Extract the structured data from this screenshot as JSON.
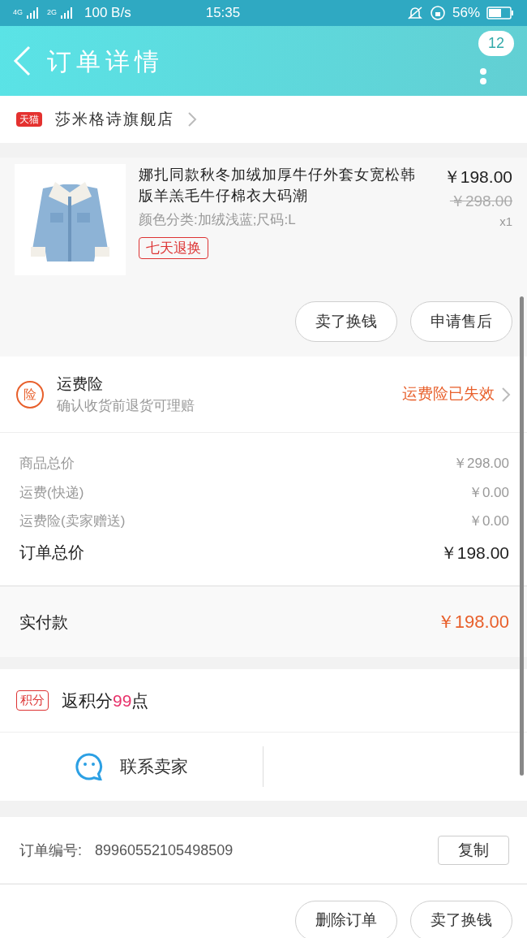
{
  "status_bar": {
    "network_1": "4G",
    "network_2": "2G",
    "speed": "100 B/s",
    "time": "15:35",
    "battery": "56%"
  },
  "header": {
    "title": "订单详情",
    "badge": "12"
  },
  "store": {
    "name": "莎米格诗旗舰店",
    "tag": "天猫"
  },
  "product": {
    "title": "娜扎同款秋冬加绒加厚牛仔外套女宽松韩版羊羔毛牛仔棉衣大码潮",
    "sku": "颜色分类:加绒浅蓝;尺码:L",
    "tag": "七天退换",
    "price": "￥198.00",
    "original_price": "￥298.00",
    "quantity": "x1",
    "actions": [
      "卖了换钱",
      "申请售后"
    ]
  },
  "insurance": {
    "icon_text": "险",
    "title": "运费险",
    "subtitle": "确认收货前退货可理赔",
    "status": "运费险已失效"
  },
  "summary": [
    {
      "label": "商品总价",
      "value": "￥298.00",
      "kind": "minor"
    },
    {
      "label": "运费(快递)",
      "value": "￥0.00",
      "kind": "minor"
    },
    {
      "label": "运费险(卖家赠送)",
      "value": "￥0.00",
      "kind": "minor"
    },
    {
      "label": "订单总价",
      "value": "￥198.00",
      "kind": "major"
    }
  ],
  "payment": {
    "label": "实付款",
    "value": "￥198.00"
  },
  "points": {
    "tag": "积分",
    "prefix": "返积分",
    "amount": "99",
    "suffix": "点"
  },
  "contact": {
    "label": "联系卖家"
  },
  "order": {
    "label": "订单编号:",
    "number": "89960552105498509",
    "copy": "复制"
  },
  "bottom_actions": [
    "删除订单",
    "卖了换钱"
  ]
}
